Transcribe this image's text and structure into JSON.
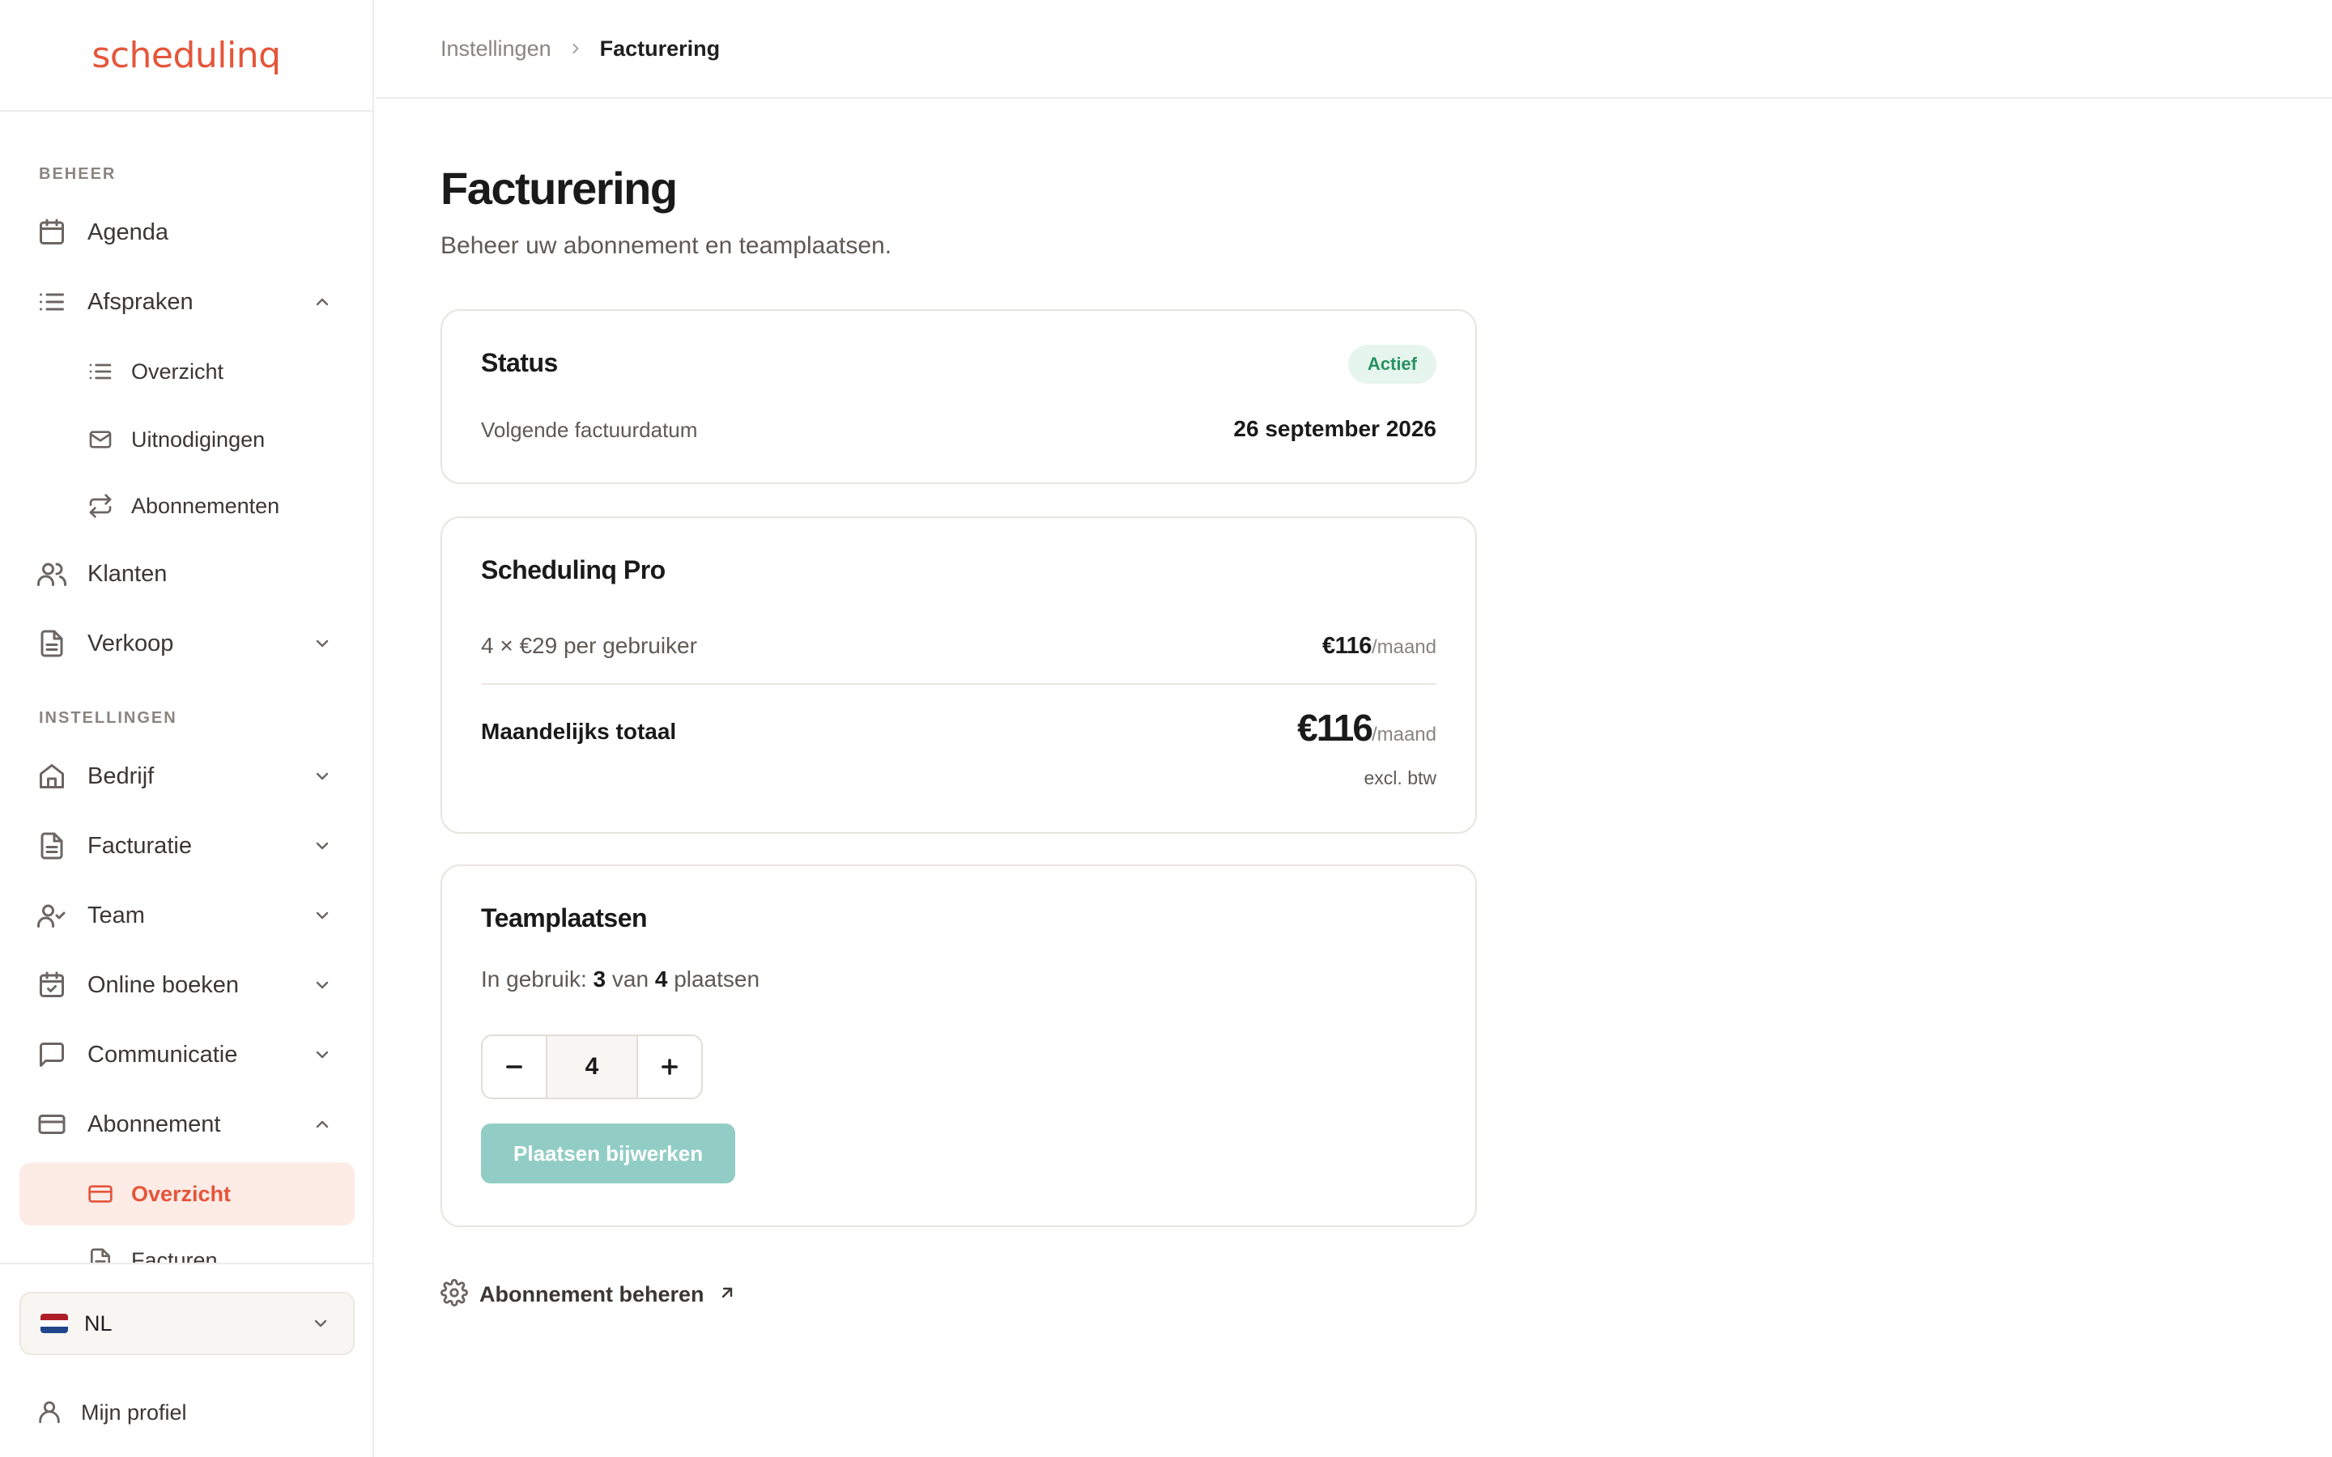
{
  "brand": {
    "logo_text": "schedulinq",
    "accent_color": "#e5553a"
  },
  "sidebar": {
    "sections": [
      {
        "label": "BEHEER"
      },
      {
        "label": "INSTELLINGEN"
      }
    ],
    "items": {
      "agenda": {
        "label": "Agenda",
        "icon": "calendar-icon"
      },
      "afspraken": {
        "label": "Afspraken",
        "icon": "list-icon",
        "expanded": true
      },
      "afspraken_overzicht": {
        "label": "Overzicht",
        "icon": "list-icon"
      },
      "uitnodigingen": {
        "label": "Uitnodigingen",
        "icon": "mail-icon"
      },
      "abonnementen": {
        "label": "Abonnementen",
        "icon": "repeat-icon"
      },
      "klanten": {
        "label": "Klanten",
        "icon": "users-icon"
      },
      "verkoop": {
        "label": "Verkoop",
        "icon": "document-icon"
      },
      "bedrijf": {
        "label": "Bedrijf",
        "icon": "home-icon"
      },
      "facturatie": {
        "label": "Facturatie",
        "icon": "document-icon"
      },
      "team": {
        "label": "Team",
        "icon": "user-check-icon"
      },
      "online_boeken": {
        "label": "Online boeken",
        "icon": "calendar-check-icon"
      },
      "communicatie": {
        "label": "Communicatie",
        "icon": "chat-icon"
      },
      "abonnement": {
        "label": "Abonnement",
        "icon": "credit-card-icon",
        "expanded": true
      },
      "abonnement_overzicht": {
        "label": "Overzicht",
        "icon": "credit-card-icon",
        "active": true
      },
      "facturen": {
        "label": "Facturen",
        "icon": "document-icon"
      }
    },
    "language": {
      "label": "NL",
      "flag_colors": [
        "#ae1c28",
        "#ffffff",
        "#21468b"
      ]
    },
    "profile": {
      "label": "Mijn profiel"
    }
  },
  "breadcrumb": {
    "parent": "Instellingen",
    "current": "Facturering"
  },
  "page": {
    "title": "Facturering",
    "subtitle": "Beheer uw abonnement en teamplaatsen."
  },
  "status_card": {
    "title": "Status",
    "badge": "Actief",
    "next_invoice_label": "Volgende factuurdatum",
    "next_invoice_date": "26 september 2026"
  },
  "plan_card": {
    "title": "Schedulinq Pro",
    "line_label": "4 × €29 per gebruiker",
    "line_amount": "€116",
    "line_period": "/maand",
    "total_label": "Maandelijks totaal",
    "total_amount": "€116",
    "total_period": "/maand",
    "tax_note": "excl. btw"
  },
  "seats_card": {
    "title": "Teamplaatsen",
    "usage_prefix": "In gebruik:",
    "used": "3",
    "usage_of": "van",
    "total": "4",
    "usage_suffix": "plaatsen",
    "stepper_value": "4",
    "update_button": "Plaatsen bijwerken"
  },
  "manage_link": {
    "label": "Abonnement beheren"
  }
}
